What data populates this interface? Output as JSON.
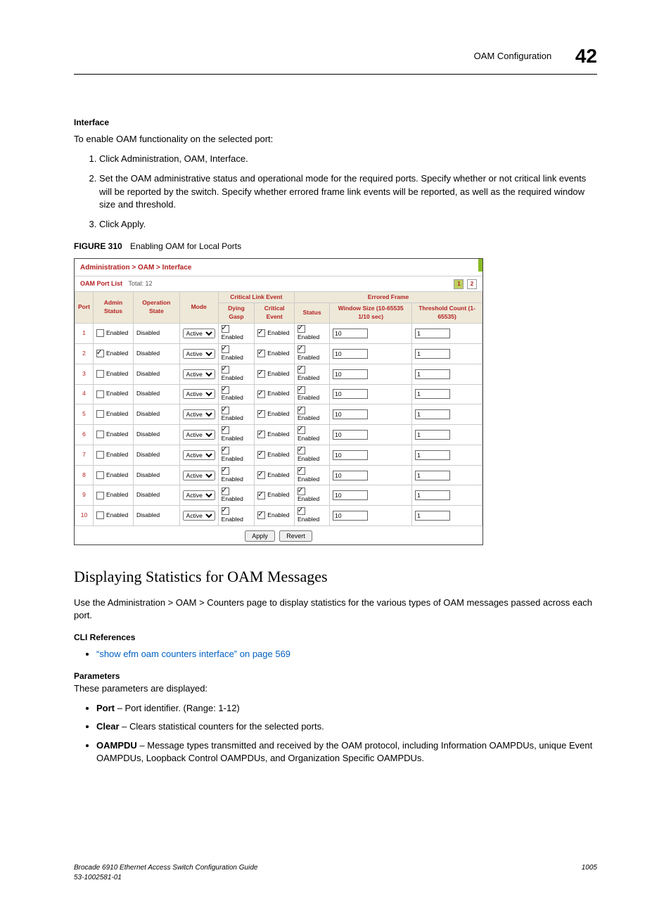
{
  "header": {
    "title": "OAM Configuration",
    "chapter": "42"
  },
  "s_interface": {
    "heading": "Interface",
    "intro": "To enable OAM functionality on the selected port:",
    "steps": [
      "Click Administration, OAM, Interface.",
      "Set the OAM administrative status and operational mode for the required ports. Specify whether or not critical link events will be reported by the switch. Specify whether errored frame link events will be reported, as well as the required window size and threshold.",
      "Click Apply."
    ]
  },
  "figure": {
    "label": "FIGURE 310",
    "title": "Enabling OAM for Local Ports",
    "crumb": "Administration > OAM > Interface",
    "list_label": "OAM Port List",
    "total_label": "Total: 12",
    "pager": [
      "1",
      "2"
    ],
    "col_port": "Port",
    "col_admin": "Admin Status",
    "col_op": "Operation State",
    "col_mode": "Mode",
    "group_cle": "Critical Link Event",
    "col_dg": "Dying Gasp",
    "col_ce": "Critical Event",
    "group_ef": "Errored Frame",
    "col_status": "Status",
    "col_ws": "Window Size (10-65535 1/10 sec)",
    "col_tc": "Threshold Count (1-65535)",
    "cell_enabled": "Enabled",
    "cell_disabled": "Disabled",
    "mode_val": "Active",
    "rows": [
      {
        "port": "1",
        "admin": false,
        "ws": "10",
        "tc": "1"
      },
      {
        "port": "2",
        "admin": true,
        "ws": "10",
        "tc": "1"
      },
      {
        "port": "3",
        "admin": false,
        "ws": "10",
        "tc": "1"
      },
      {
        "port": "4",
        "admin": false,
        "ws": "10",
        "tc": "1"
      },
      {
        "port": "5",
        "admin": false,
        "ws": "10",
        "tc": "1"
      },
      {
        "port": "6",
        "admin": false,
        "ws": "10",
        "tc": "1"
      },
      {
        "port": "7",
        "admin": false,
        "ws": "10",
        "tc": "1"
      },
      {
        "port": "8",
        "admin": false,
        "ws": "10",
        "tc": "1"
      },
      {
        "port": "9",
        "admin": false,
        "ws": "10",
        "tc": "1"
      },
      {
        "port": "10",
        "admin": false,
        "ws": "10",
        "tc": "1"
      }
    ],
    "btn_apply": "Apply",
    "btn_revert": "Revert"
  },
  "s_stats": {
    "heading": "Displaying Statistics for OAM Messages",
    "intro": "Use the Administration > OAM > Counters page to display statistics for the various types of OAM messages passed across each port.",
    "cli_head": "CLI References",
    "cli_link": "“show efm oam counters interface” on page 569",
    "params_head": "Parameters",
    "params_intro": "These parameters are displayed:",
    "p_port_name": "Port",
    "p_port_desc": " – Port identifier. (Range: 1-12)",
    "p_clear_name": "Clear",
    "p_clear_desc": " – Clears statistical counters for the selected ports.",
    "p_oampdu_name": "OAMPDU",
    "p_oampdu_desc": " – Message types transmitted and received by the OAM protocol, including Information OAMPDUs, unique Event OAMPDUs, Loopback Control OAMPDUs, and Organization Specific OAMPDUs."
  },
  "footer": {
    "left1": "Brocade 6910 Ethernet Access Switch Configuration Guide",
    "left2": "53-1002581-01",
    "right": "1005"
  }
}
